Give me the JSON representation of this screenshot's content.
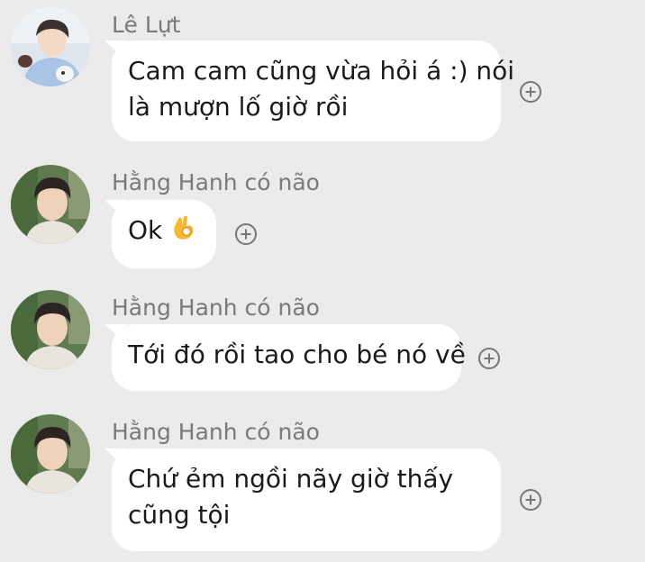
{
  "messages": [
    {
      "sender": "Lê Lựt",
      "lines": [
        "Cam cam cũng vừa hỏi á :) nói",
        "là mượn lố giờ rồi"
      ]
    },
    {
      "sender": "Hằng Hanh có não",
      "text": "Ok",
      "emoji": "ok-hand-emoji"
    },
    {
      "sender": "Hằng Hanh có não",
      "lines": [
        "Tới đó rồi tao cho bé nó về"
      ]
    },
    {
      "sender": "Hằng Hanh có não",
      "lines": [
        "Chứ ẻm ngồi nãy giờ thấy",
        "cũng tội"
      ]
    }
  ],
  "icons": {
    "reaction": "add-reaction-icon"
  },
  "colors": {
    "background": "#ebebeb",
    "bubble": "#ffffff",
    "sender_name": "#7a7a7a",
    "text": "#1a1a1a"
  }
}
